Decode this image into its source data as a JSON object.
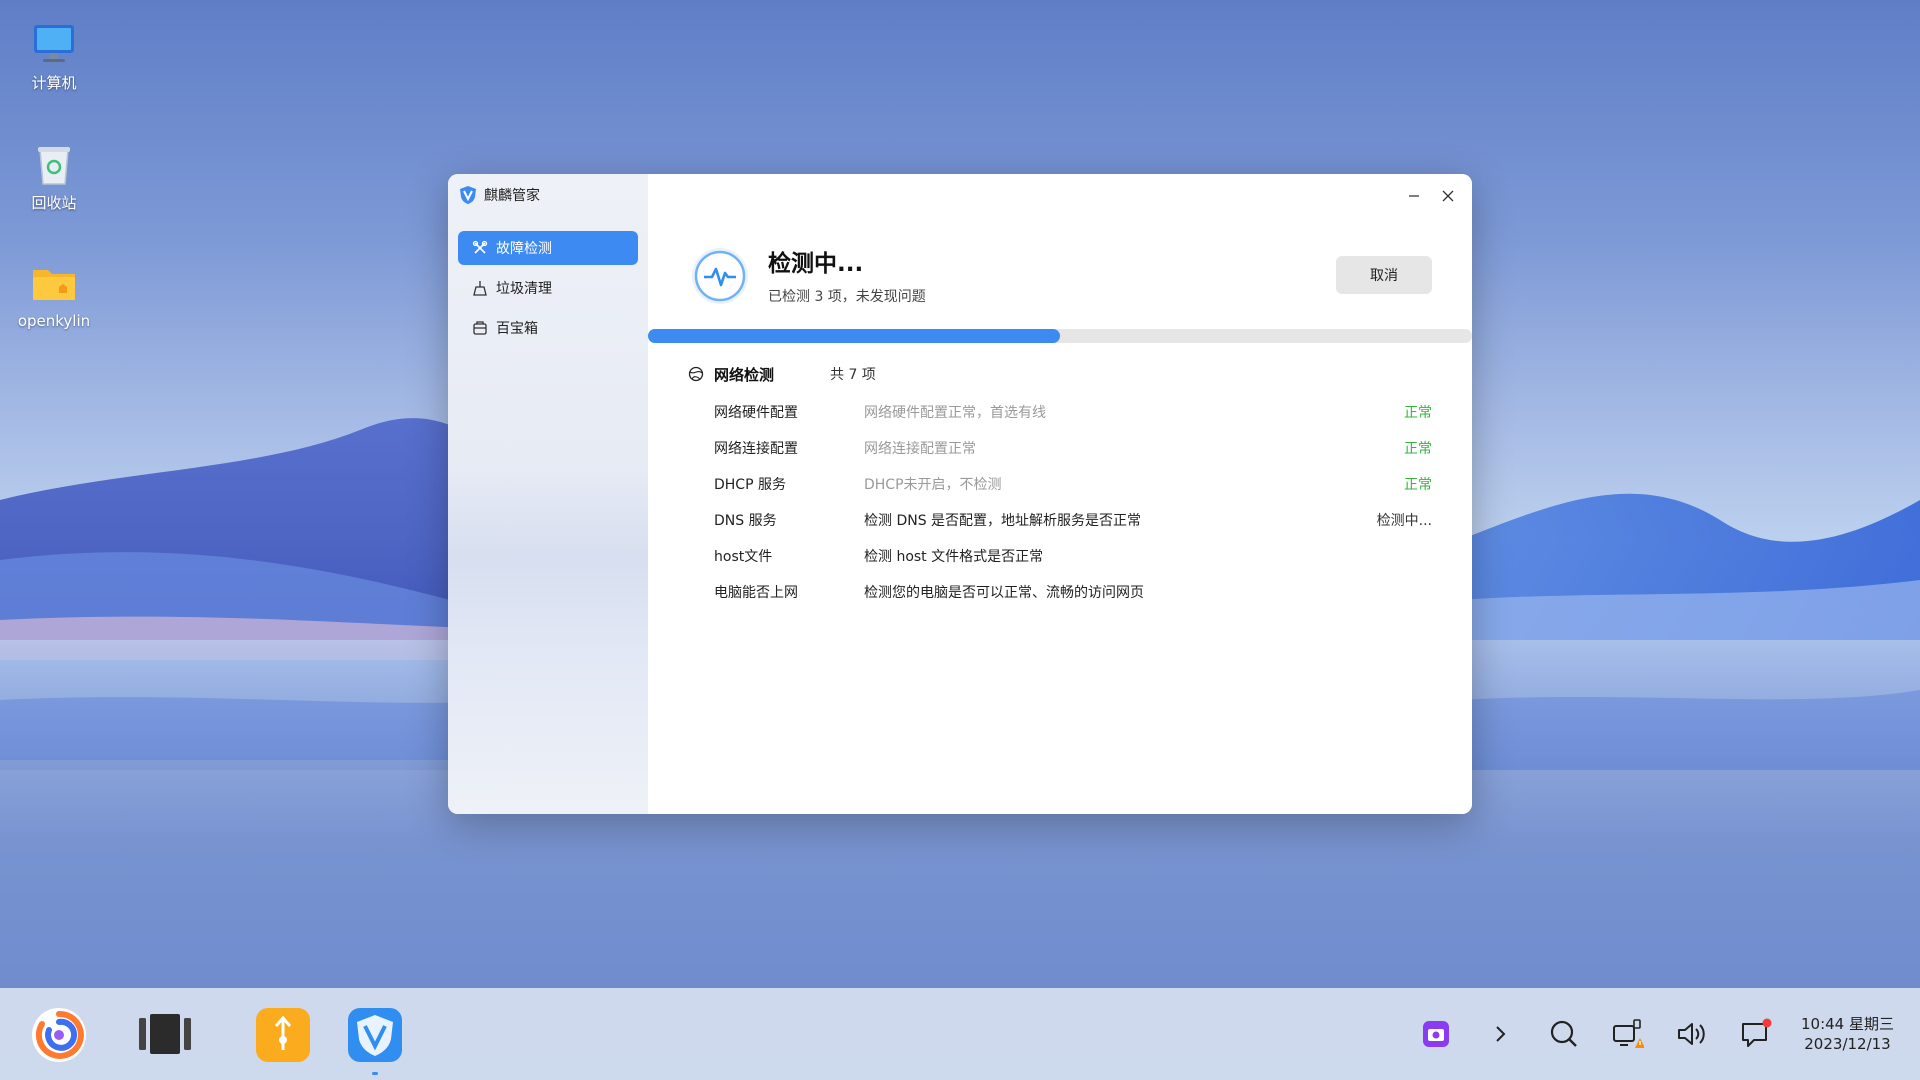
{
  "desktop": {
    "icons": [
      {
        "label": "计算机",
        "icon": "monitor-icon"
      },
      {
        "label": "回收站",
        "icon": "recycle-bin-icon"
      },
      {
        "label": "openkylin",
        "icon": "home-folder-icon"
      }
    ]
  },
  "window": {
    "app_title": "麒麟管家",
    "sidebar": {
      "items": [
        {
          "label": "故障检测",
          "icon": "tools-icon",
          "active": true
        },
        {
          "label": "垃圾清理",
          "icon": "broom-icon",
          "active": false
        },
        {
          "label": "百宝箱",
          "icon": "toolbox-icon",
          "active": false
        }
      ]
    },
    "status": {
      "title": "检测中...",
      "subtitle": "已检测 3 项，未发现问题",
      "cancel_label": "取消",
      "progress": 0.5
    },
    "section": {
      "title": "网络检测",
      "count": "共 7 项"
    },
    "checks": [
      {
        "name": "网络硬件配置",
        "desc": "网络硬件配置正常，首选有线",
        "status": "正常",
        "state": "done"
      },
      {
        "name": "网络连接配置",
        "desc": "网络连接配置正常",
        "status": "正常",
        "state": "done"
      },
      {
        "name": "DHCP 服务",
        "desc": "DHCP未开启，不检测",
        "status": "正常",
        "state": "done"
      },
      {
        "name": "DNS 服务",
        "desc": "检测 DNS 是否配置，地址解析服务是否正常",
        "status": "检测中...",
        "state": "running"
      },
      {
        "name": "host文件",
        "desc": "检测 host 文件格式是否正常",
        "status": "",
        "state": "pending"
      },
      {
        "name": "电脑能否上网",
        "desc": "检测您的电脑是否可以正常、流畅的访问网页",
        "status": "",
        "state": "pending"
      }
    ],
    "colors": {
      "accent": "#3d8bf2",
      "ok": "#34b63a"
    }
  },
  "taskbar": {
    "apps": [
      "start-menu-icon",
      "multitask-view-icon",
      "file-transfer-icon",
      "kylin-manager-icon"
    ],
    "tray": [
      "screenshot-icon",
      "expand-arrow-icon",
      "search-icon",
      "network-warning-icon",
      "volume-icon",
      "notification-icon"
    ],
    "clock": {
      "time": "10:44 星期三",
      "date": "2023/12/13"
    }
  }
}
